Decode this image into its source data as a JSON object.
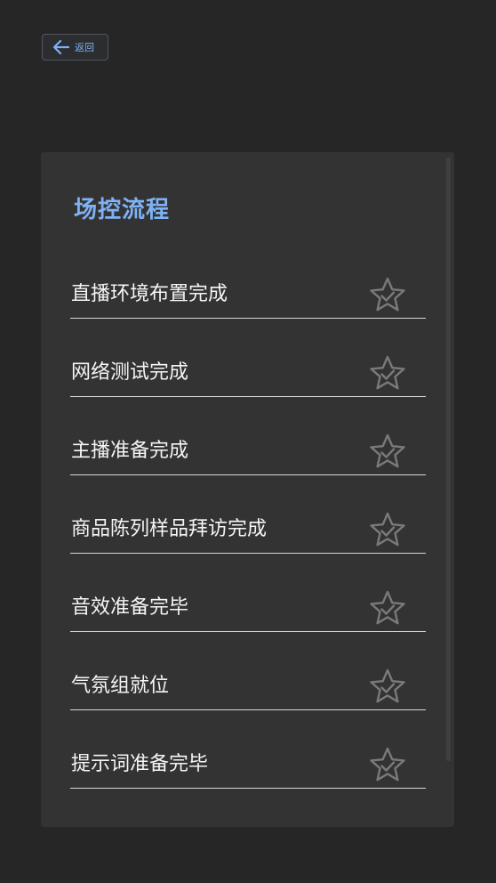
{
  "header": {
    "back_label": "返回"
  },
  "panel": {
    "title": "场控流程",
    "items": [
      {
        "label": "直播环境布置完成",
        "icon": "star-check-icon",
        "checked": false
      },
      {
        "label": "网络测试完成",
        "icon": "star-check-icon",
        "checked": false
      },
      {
        "label": "主播准备完成",
        "icon": "star-check-icon",
        "checked": false
      },
      {
        "label": "商品陈列样品拜访完成",
        "icon": "star-check-icon",
        "checked": false
      },
      {
        "label": "音效准备完毕",
        "icon": "star-check-icon",
        "checked": false
      },
      {
        "label": "气氛组就位",
        "icon": "star-check-icon",
        "checked": false
      },
      {
        "label": "提示词准备完毕",
        "icon": "star-check-icon",
        "checked": false
      }
    ]
  },
  "colors": {
    "background": "#262626",
    "panel": "#333333",
    "accent": "#7fb2f5",
    "icon_gray": "#7a7a7a"
  }
}
